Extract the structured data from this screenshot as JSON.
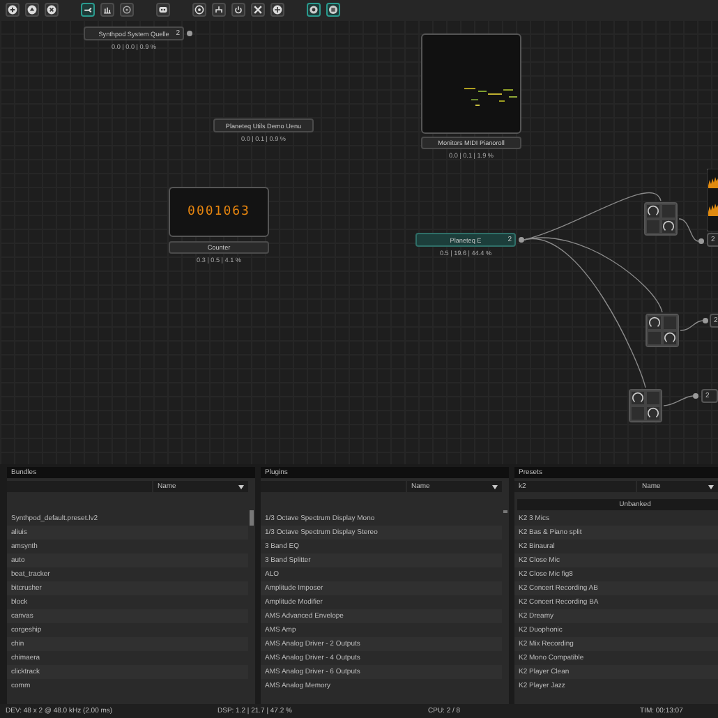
{
  "toolbar": [
    {
      "kind": "add",
      "selected": false
    },
    {
      "kind": "load",
      "selected": false
    },
    {
      "kind": "close",
      "selected": false
    },
    {
      "kind": "connect",
      "selected": true
    },
    {
      "kind": "meter",
      "selected": false
    },
    {
      "kind": "settings",
      "selected": false
    },
    {
      "kind": "robot",
      "selected": false
    },
    {
      "kind": "target",
      "selected": false
    },
    {
      "kind": "tree",
      "selected": false
    },
    {
      "kind": "power",
      "selected": false
    },
    {
      "kind": "shuffle",
      "selected": false
    },
    {
      "kind": "move",
      "selected": false
    },
    {
      "kind": "gear",
      "selected": true
    },
    {
      "kind": "stop",
      "selected": true
    }
  ],
  "nodes": [
    {
      "kind": "plain",
      "title": "Synthpod System Quelle",
      "badge": "2",
      "stats": "0.0 | 0.0 | 0.9 %",
      "selected": false
    },
    {
      "kind": "plain",
      "title": "Planeteq Utils Demo Uenu",
      "stats": "0.0 | 0.1 | 0.9 %",
      "selected": false
    },
    {
      "kind": "pianoroll",
      "title": "Monitors MIDI Pianoroll",
      "stats": "0.0 | 0.1 | 1.9 %",
      "selected": false
    },
    {
      "kind": "counter",
      "display": "0001063",
      "title": "Counter",
      "stats": "0.3 | 0.5 | 4.1 %",
      "selected": false
    },
    {
      "kind": "plain",
      "title": "Planeteq E",
      "badge": "2",
      "stats": "0.5 | 19.6 | 44.4 %",
      "selected": true
    }
  ],
  "mixers": [
    {
      "output": "2"
    },
    {
      "output": "2"
    },
    {
      "output": "2"
    }
  ],
  "panels": [
    {
      "title": "Bundles",
      "sort": "Name",
      "rows": [
        "Synthpod_default.preset.lv2",
        "aliuis",
        "amsynth",
        "auto",
        "beat_tracker",
        "bitcrusher",
        "block",
        "canvas",
        "corgeship",
        "chin",
        "chimaera",
        "clicktrack",
        "comm"
      ]
    },
    {
      "title": "Plugins",
      "sort": "Name",
      "rows": [
        "1/3 Octave Spectrum Display Mono",
        "1/3 Octave Spectrum Display Stereo",
        "3 Band EQ",
        "3 Band Splitter",
        "ALO",
        "Amplitude Imposer",
        "Amplitude Modifier",
        "AMS Advanced Envelope",
        "AMS Amp",
        "AMS Analog Driver - 2 Outputs",
        "AMS Analog Driver - 4 Outputs",
        "AMS Analog Driver - 6 Outputs",
        "AMS Analog Memory"
      ]
    },
    {
      "title": "Presets",
      "search": "k2",
      "sort": "Name",
      "group": "Unbanked",
      "rows": [
        "K2 3 Mics",
        "K2 Bas & Piano split",
        "K2 Binaural",
        "K2 Close Mic",
        "K2 Close Mic fig8",
        "K2 Concert Recording AB",
        "K2 Concert Recording BA",
        "K2 Dreamy",
        "K2 Duophonic",
        "K2 Mix Recording",
        "K2 Mono Compatible",
        "K2 Player Clean",
        "K2 Player Jazz"
      ]
    }
  ],
  "status_bar": [
    "DEV: 48 x 2 @ 48.0 kHz (2.00 ms)",
    "DSP: 1.2 | 21.7 | 47.2 %",
    "CPU: 2 / 8",
    "TIM: 00:13:07"
  ]
}
